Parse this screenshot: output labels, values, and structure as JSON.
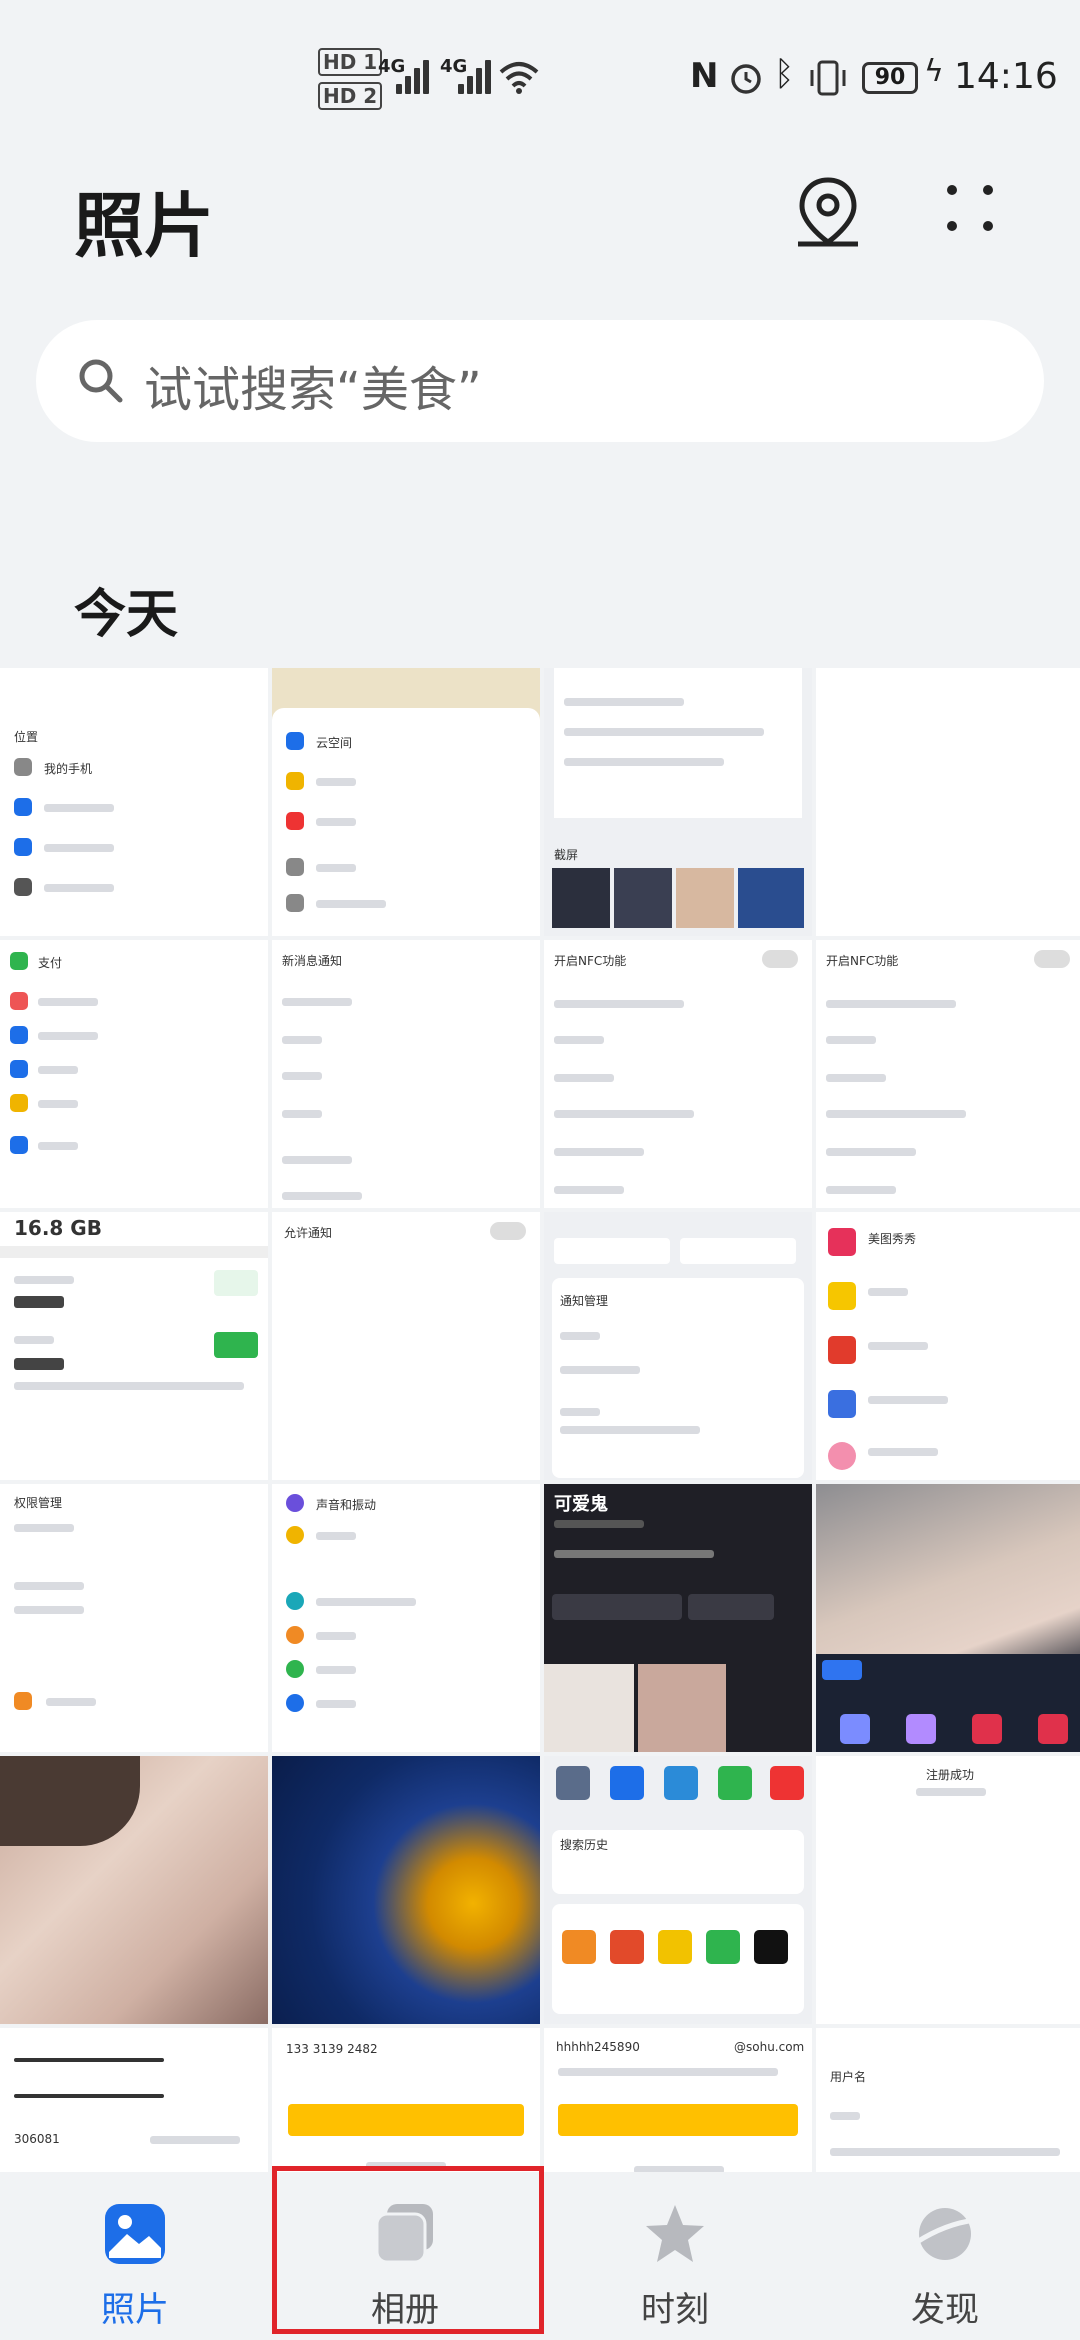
{
  "status_bar": {
    "hd1": "HD 1",
    "hd2": "HD 2",
    "net1": "4G",
    "net2": "4G",
    "battery": "90",
    "time": "14:16"
  },
  "header": {
    "title": "照片",
    "location_icon": "location-pin-icon",
    "more_icon": "more-dots-icon"
  },
  "search": {
    "placeholder": "试试搜索“美食”"
  },
  "section": {
    "title": "今天"
  },
  "thumbnails": [
    {
      "id": "shot-1",
      "caption": "我的手机"
    },
    {
      "id": "shot-2",
      "caption": "云空间"
    },
    {
      "id": "shot-3",
      "caption": "截屏"
    },
    {
      "id": "shot-4",
      "caption": ""
    },
    {
      "id": "shot-5",
      "caption": "支付"
    },
    {
      "id": "shot-6",
      "caption": "新消息通知"
    },
    {
      "id": "shot-7",
      "caption": "开启NFC功能"
    },
    {
      "id": "shot-8",
      "caption": "开启NFC功能"
    },
    {
      "id": "shot-9",
      "caption": "16.8 GB"
    },
    {
      "id": "shot-10",
      "caption": "允许通知"
    },
    {
      "id": "shot-11",
      "caption": "通知管理"
    },
    {
      "id": "shot-12",
      "caption": "美图秀秀"
    },
    {
      "id": "shot-13",
      "caption": "权限管理"
    },
    {
      "id": "shot-14",
      "caption": "声音和振动"
    },
    {
      "id": "shot-15",
      "caption": "可爱鬼"
    },
    {
      "id": "shot-16",
      "caption": ""
    },
    {
      "id": "shot-17",
      "caption": ""
    },
    {
      "id": "shot-18",
      "caption": ""
    },
    {
      "id": "shot-19",
      "caption": "搜索历史"
    },
    {
      "id": "shot-20",
      "caption": "注册成功"
    },
    {
      "id": "shot-21",
      "caption": "306081"
    },
    {
      "id": "shot-22",
      "caption": "133 3139 2482"
    },
    {
      "id": "shot-23",
      "caption": "hhhhh245890"
    },
    {
      "id": "shot-24",
      "caption": "用户名"
    }
  ],
  "bottom_nav": {
    "tabs": [
      {
        "label": "照片",
        "icon": "photos-icon",
        "active": true
      },
      {
        "label": "相册",
        "icon": "albums-icon",
        "active": false
      },
      {
        "label": "时刻",
        "icon": "moments-star-icon",
        "active": false
      },
      {
        "label": "发现",
        "icon": "discover-planet-icon",
        "active": false
      }
    ]
  },
  "colors": {
    "accent": "#1d6ee8",
    "highlight": "#e0242a",
    "background": "#f1f3f5"
  }
}
